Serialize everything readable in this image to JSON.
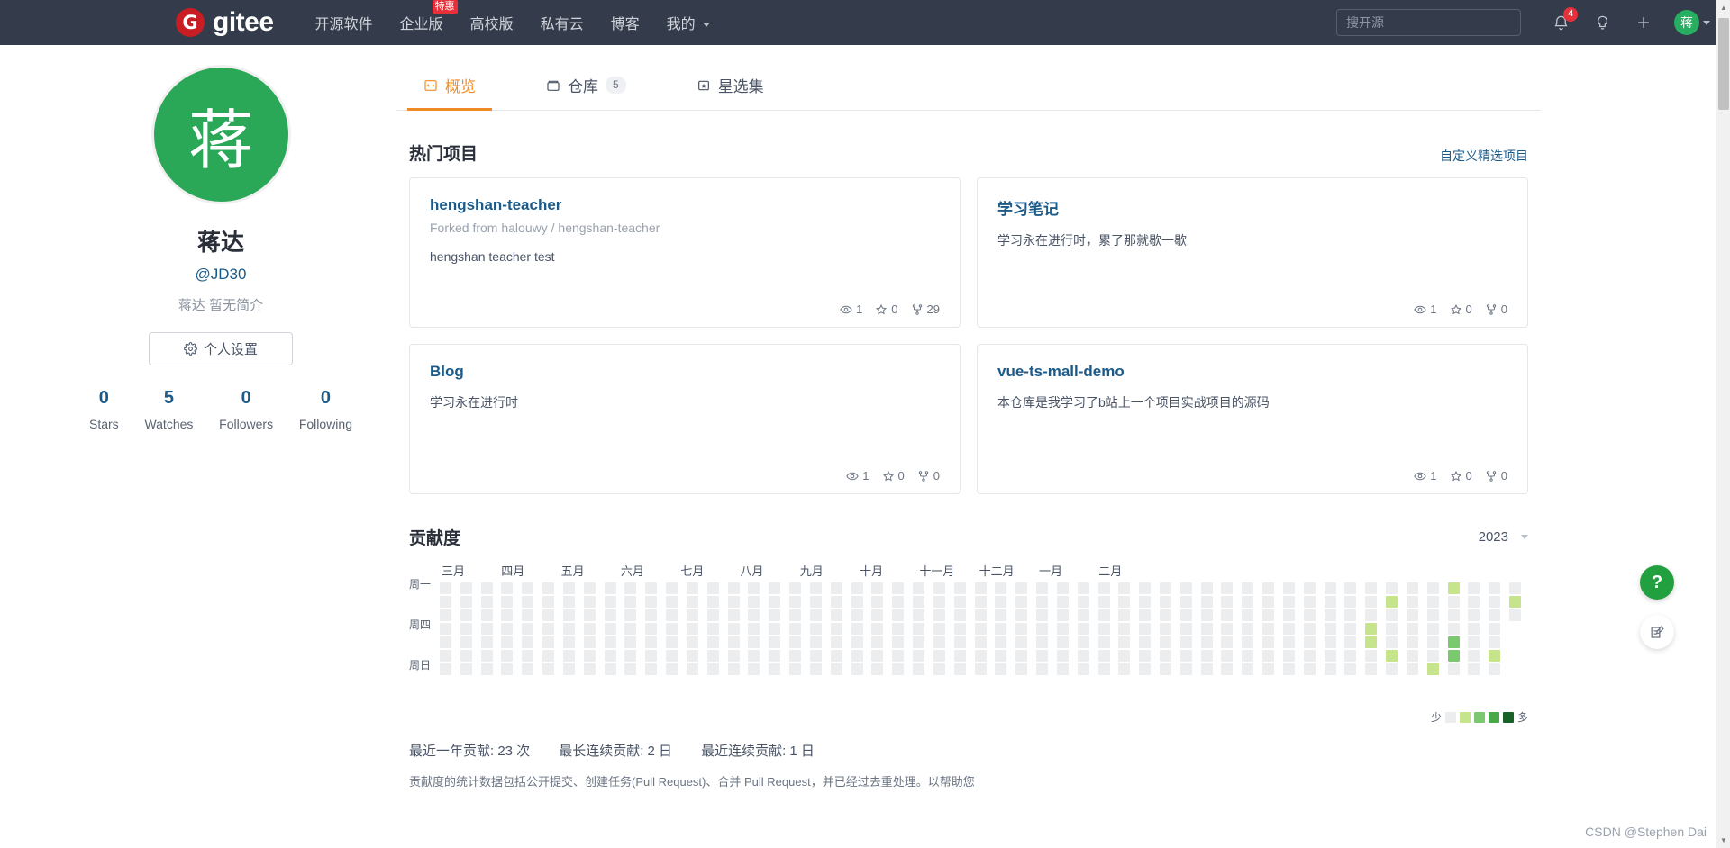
{
  "navbar": {
    "logo_text": "gitee",
    "logo_mark": "G",
    "links": [
      {
        "label": "开源软件",
        "badge": null
      },
      {
        "label": "企业版",
        "badge": "特惠"
      },
      {
        "label": "高校版",
        "badge": null
      },
      {
        "label": "私有云",
        "badge": null
      },
      {
        "label": "博客",
        "badge": null
      },
      {
        "label": "我的",
        "badge": null,
        "has_caret": true
      }
    ],
    "search_placeholder": "搜开源",
    "search_value": "",
    "notification_count": "4",
    "avatar_letter": "蒋"
  },
  "profile": {
    "avatar_letter": "蒋",
    "name": "蒋达",
    "handle": "@JD30",
    "bio": "蒋达 暂无简介",
    "settings_label": "个人设置",
    "stats": [
      {
        "value": "0",
        "label": "Stars"
      },
      {
        "value": "5",
        "label": "Watches"
      },
      {
        "value": "0",
        "label": "Followers"
      },
      {
        "value": "0",
        "label": "Following"
      }
    ]
  },
  "tabs": [
    {
      "label": "概览",
      "icon": "code-overview-icon",
      "badge": null,
      "active": true
    },
    {
      "label": "仓库",
      "icon": "repository-icon",
      "badge": "5",
      "active": false
    },
    {
      "label": "星选集",
      "icon": "star-collection-icon",
      "badge": null,
      "active": false
    }
  ],
  "popular": {
    "title": "热门项目",
    "customize_link": "自定义精选项目",
    "projects": [
      {
        "name": "hengshan-teacher",
        "forked_prefix": "Forked from",
        "forked_owner": "halouwy",
        "forked_sep": "/",
        "forked_repo": "hengshan-teacher",
        "description": "hengshan teacher test",
        "watches": "1",
        "stars": "0",
        "forks": "29"
      },
      {
        "name": "学习笔记",
        "forked_prefix": null,
        "forked_owner": null,
        "forked_sep": null,
        "forked_repo": null,
        "description": "学习永在进行时，累了那就歇一歇",
        "watches": "1",
        "stars": "0",
        "forks": "0"
      },
      {
        "name": "Blog",
        "forked_prefix": null,
        "forked_owner": null,
        "forked_sep": null,
        "forked_repo": null,
        "description": "学习永在进行时",
        "watches": "1",
        "stars": "0",
        "forks": "0"
      },
      {
        "name": "vue-ts-mall-demo",
        "forked_prefix": null,
        "forked_owner": null,
        "forked_sep": null,
        "forked_repo": null,
        "description": "本仓库是我学习了b站上一个项目实战项目的源码",
        "watches": "1",
        "stars": "0",
        "forks": "0"
      }
    ]
  },
  "contribution": {
    "title": "贡献度",
    "year": "2023",
    "months": [
      "三月",
      "四月",
      "五月",
      "六月",
      "七月",
      "八月",
      "九月",
      "十月",
      "十一月",
      "十二月",
      "一月",
      "二月"
    ],
    "day_labels": [
      "周一",
      "周四",
      "周日"
    ],
    "legend_less": "少",
    "legend_more": "多",
    "legend_colors": [
      "#ebedef",
      "#c6e48b",
      "#7bc96f",
      "#49a849",
      "#196127"
    ],
    "stats": [
      "最近一年贡献: 23 次",
      "最长连续贡献: 2 日",
      "最近连续贡献: 1 日"
    ],
    "footer_note": "贡献度的统计数据包括公开提交、创建任务(Pull Request)、合并 Pull Request，并已经过去重处理。以帮助您",
    "active_cells": [
      {
        "col": 45,
        "row": 3,
        "level": 1
      },
      {
        "col": 45,
        "row": 4,
        "level": 1
      },
      {
        "col": 46,
        "row": 1,
        "level": 1
      },
      {
        "col": 46,
        "row": 5,
        "level": 1
      },
      {
        "col": 48,
        "row": 6,
        "level": 1
      },
      {
        "col": 49,
        "row": 0,
        "level": 1
      },
      {
        "col": 49,
        "row": 4,
        "level": 2
      },
      {
        "col": 49,
        "row": 5,
        "level": 2
      },
      {
        "col": 51,
        "row": 5,
        "level": 1
      },
      {
        "col": 52,
        "row": 1,
        "level": 1
      }
    ]
  },
  "floating": {
    "help_label": "?",
    "feedback_icon": "feedback-edit-icon"
  },
  "watermark": "CSDN @Stephen Dai"
}
